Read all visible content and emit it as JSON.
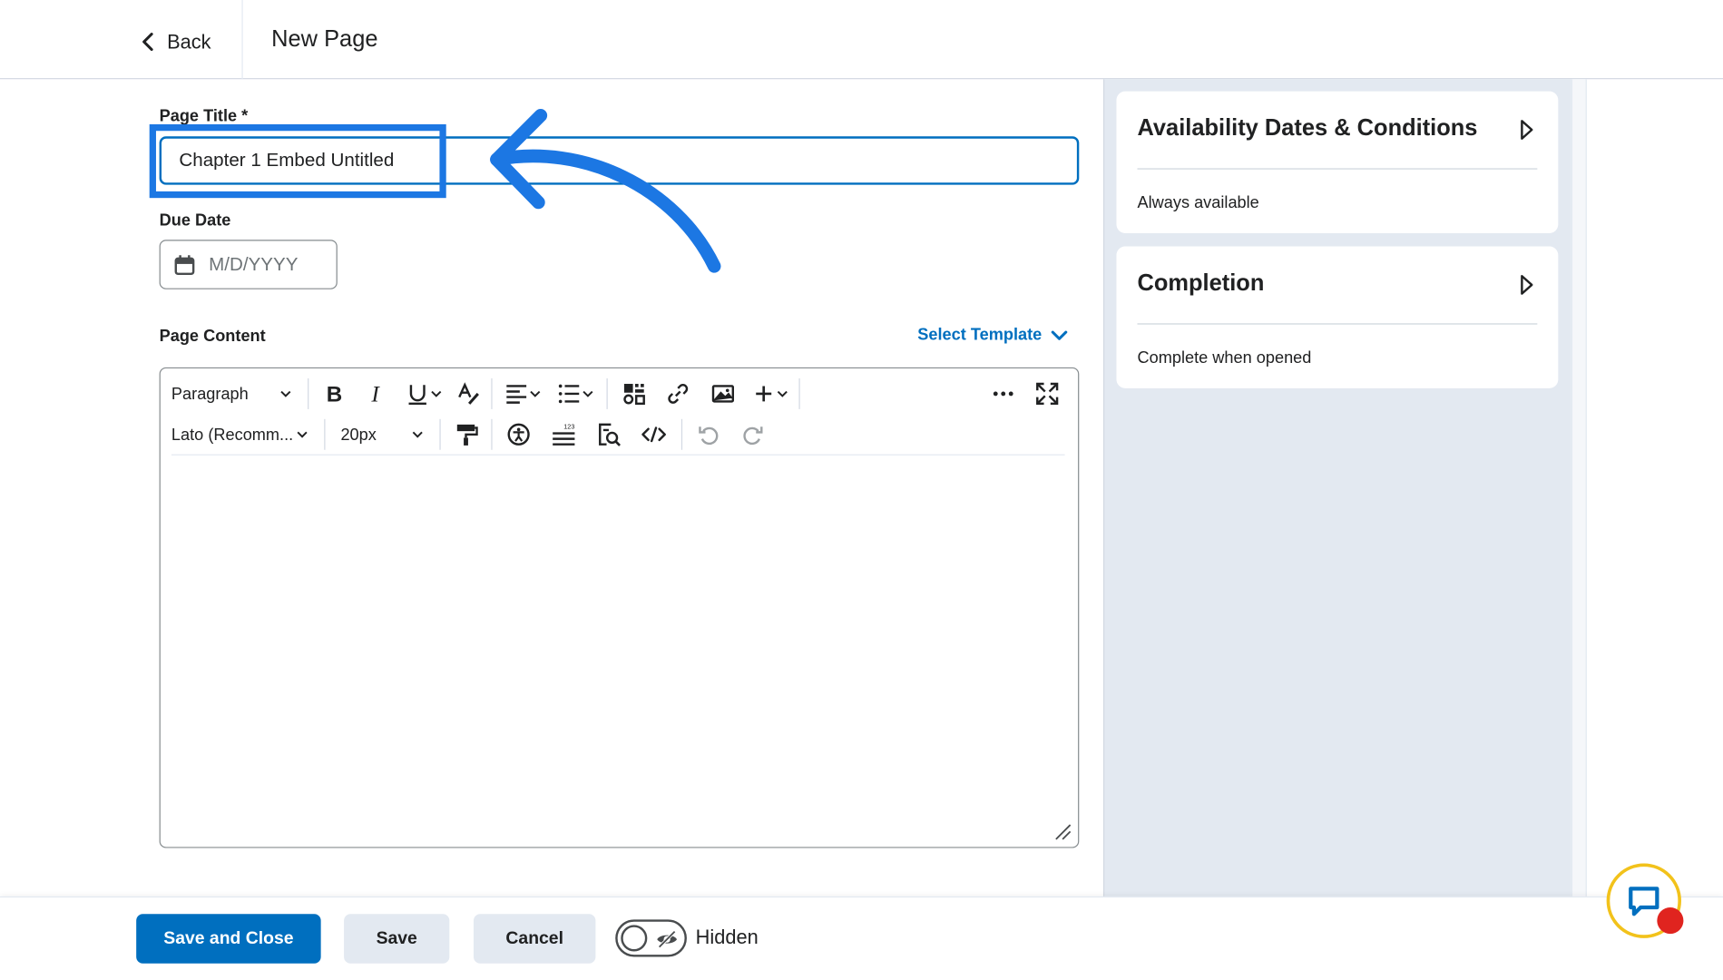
{
  "header": {
    "back_label": "Back",
    "page_heading": "New Page"
  },
  "form": {
    "title_label": "Page Title *",
    "title_value": "Chapter 1 Embed Untitled",
    "due_label": "Due Date",
    "due_placeholder": "M/D/YYYY",
    "content_label": "Page Content",
    "select_template": "Select Template"
  },
  "toolbar": {
    "block_format": "Paragraph",
    "font_family": "Lato (Recomm...",
    "font_size": "20px"
  },
  "cards": [
    {
      "title": "Availability Dates & Conditions",
      "subtitle": "Always available"
    },
    {
      "title": "Completion",
      "subtitle": "Complete when opened"
    }
  ],
  "footer": {
    "save_close": "Save and Close",
    "save": "Save",
    "cancel": "Cancel",
    "visibility_label": "Hidden"
  },
  "colors": {
    "accent": "#006fbf",
    "annotation": "#1c77e3",
    "panel_bg": "#e3e9f1",
    "chat_ring": "#f2c21b",
    "chat_dot": "#e0241f"
  },
  "icons": [
    "chevron-left-icon",
    "calendar-icon",
    "chevron-down-icon",
    "bold-icon",
    "italic-icon",
    "underline-icon",
    "text-color-icon",
    "align-icon",
    "list-icon",
    "insert-stuff-icon",
    "link-icon",
    "image-icon",
    "plus-icon",
    "more-icon",
    "fullscreen-icon",
    "format-painter-icon",
    "accessibility-icon",
    "word-count-icon",
    "preview-icon",
    "source-code-icon",
    "undo-icon",
    "redo-icon",
    "chevron-right-icon",
    "eye-off-icon",
    "chat-icon"
  ]
}
